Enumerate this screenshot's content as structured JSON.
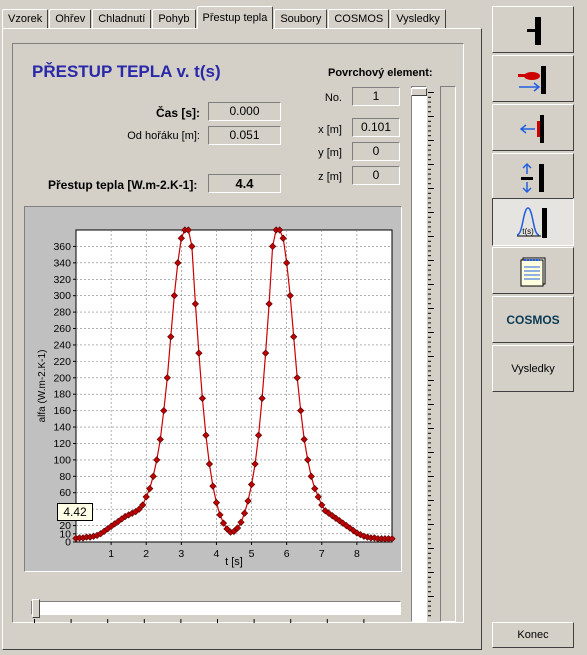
{
  "tabs": [
    "Vzorek",
    "Ohřev",
    "Chladnutí",
    "Pohyb",
    "Přestup tepla",
    "Soubory",
    "COSMOS",
    "Vysledky"
  ],
  "active_tab": "Přestup tepla",
  "title": "PŘESTUP TEPLA v. t(s)",
  "cas_label": "Čas [s]:",
  "cas_value": "0.000",
  "od_horaku_label": "Od hořáku [m]:",
  "od_horaku_value": "0.051",
  "prestup_label": "Přestup tepla [W.m-2.K-1]:",
  "prestup_value": "4.4",
  "element": {
    "header": "Povrchový element:",
    "no_label": "No.",
    "no_value": "1",
    "x_label": "x [m]",
    "x_value": "0.101",
    "y_label": "y [m]",
    "y_value": "0",
    "z_label": "z [m]",
    "z_value": "0"
  },
  "cursor_value": "4.42",
  "right_buttons": {
    "cosmos": "COSMOS",
    "vysledky": "Vysledky",
    "konec": "Konec"
  },
  "colors": {
    "title": "#2828a8",
    "series_line": "#cc0000",
    "marker_fill": "#c00000",
    "plot_bg": "#ffffff",
    "chart_frame": "#c0c0c0",
    "arrow_blue": "#2060e0"
  },
  "chart_data": {
    "type": "line",
    "xlabel": "t [s]",
    "ylabel": "alfa (W.m-2.K-1)",
    "xlim": [
      0,
      9
    ],
    "ylim": [
      0,
      380
    ],
    "xticks": [
      1,
      2,
      3,
      4,
      5,
      6,
      7,
      8
    ],
    "yticks": [
      0,
      10,
      20,
      40,
      60,
      80,
      100,
      120,
      140,
      160,
      180,
      200,
      220,
      240,
      260,
      280,
      300,
      320,
      340,
      360
    ],
    "grid": true,
    "series": [
      {
        "x": [
          0.0,
          0.1,
          0.2,
          0.3,
          0.4,
          0.5,
          0.6,
          0.7,
          0.8,
          0.9,
          1.0,
          1.1,
          1.2,
          1.3,
          1.4,
          1.5,
          1.6,
          1.7,
          1.8,
          1.9,
          2.0,
          2.1,
          2.2,
          2.3,
          2.4,
          2.5,
          2.6,
          2.7,
          2.8,
          2.9,
          3.0,
          3.1,
          3.2,
          3.3,
          3.4,
          3.5,
          3.6,
          3.7,
          3.8,
          3.9,
          4.0,
          4.1,
          4.2,
          4.3,
          4.4,
          4.5,
          4.6,
          4.7,
          4.8,
          4.9,
          5.0,
          5.1,
          5.2,
          5.3,
          5.4,
          5.5,
          5.6,
          5.7,
          5.8,
          5.9,
          6.0,
          6.1,
          6.2,
          6.3,
          6.4,
          6.5,
          6.6,
          6.7,
          6.8,
          6.9,
          7.0,
          7.1,
          7.2,
          7.3,
          7.4,
          7.5,
          7.6,
          7.7,
          7.8,
          7.9,
          8.0,
          8.1,
          8.2,
          8.3,
          8.4,
          8.5,
          8.6,
          8.7,
          8.8,
          8.9,
          9.0
        ],
        "y": [
          4.4,
          5,
          5,
          6,
          6,
          7,
          8,
          10,
          13,
          16,
          19,
          22,
          25,
          28,
          31,
          33,
          35,
          37,
          40,
          45,
          55,
          65,
          80,
          100,
          125,
          160,
          200,
          250,
          300,
          340,
          370,
          380,
          380,
          360,
          290,
          230,
          175,
          130,
          95,
          68,
          48,
          33,
          23,
          16,
          12,
          13,
          17,
          24,
          35,
          50,
          70,
          95,
          130,
          175,
          230,
          290,
          360,
          380,
          380,
          370,
          340,
          300,
          250,
          200,
          160,
          125,
          100,
          80,
          65,
          55,
          45,
          38,
          35,
          32,
          29,
          26,
          23,
          20,
          17,
          14,
          11,
          9,
          7,
          6,
          5,
          5,
          4,
          4,
          4,
          4,
          4
        ]
      }
    ]
  }
}
